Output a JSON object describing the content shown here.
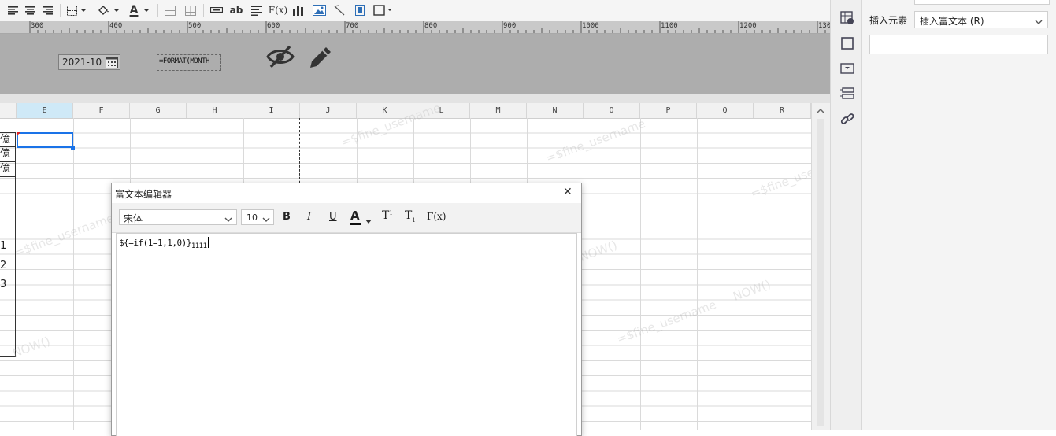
{
  "toolbar": {
    "icons": [
      "align-left-icon",
      "align-center-icon",
      "align-right-icon",
      "border-icon",
      "fill-color-icon",
      "font-color-icon",
      "merge-icon",
      "unmerge-icon",
      "insert-row-icon",
      "text-ab-icon",
      "align-icon",
      "formula-icon",
      "chart-icon",
      "image-icon",
      "slash-icon",
      "subreport-icon",
      "border-box-icon"
    ],
    "font_color_letter": "A",
    "text_ab": "ab",
    "formula_label": "F(x)"
  },
  "ruler": {
    "labels": [
      "300",
      "400",
      "500",
      "600",
      "700",
      "800",
      "900",
      "1000",
      "1100",
      "1200",
      "130"
    ]
  },
  "band": {
    "date_value": "2021-10",
    "formula_text": "=FORMAT(MONTH"
  },
  "columns": [
    "E",
    "F",
    "G",
    "H",
    "I",
    "J",
    "K",
    "L",
    "M",
    "N",
    "O",
    "P",
    "Q",
    "R"
  ],
  "left_cells": [
    "億",
    "億",
    "億"
  ],
  "row_numbers": [
    "1",
    "2",
    "3"
  ],
  "watermark": "=$fine_username",
  "watermark2": "NOW()",
  "dialog": {
    "title": "富文本编辑器",
    "close_glyph": "✕",
    "font_family": "宋体",
    "font_size": "10",
    "bold": "B",
    "italic": "I",
    "underline": "U",
    "font_color": "A",
    "superscript": "T",
    "superscript_mark": "1",
    "subscript": "T",
    "subscript_mark": "1",
    "formula": "F(x)",
    "content_main": "${=if(1=1,1,0)}",
    "content_sub": "1111"
  },
  "right_panel": {
    "insert_label": "插入元素",
    "insert_value": "插入富文本 (R)"
  },
  "colors": {
    "band": "#adadad",
    "selection": "#1a73e8",
    "active_col": "#cfe9f7"
  }
}
